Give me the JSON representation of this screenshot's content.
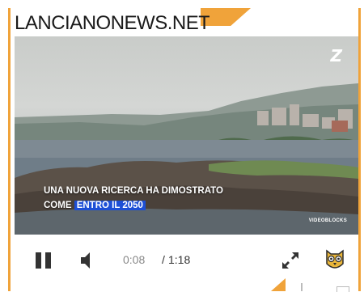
{
  "site": {
    "title": "LANCIANONEWS.NET"
  },
  "video": {
    "logo": "Z",
    "caption_line1": "UNA NUOVA RICERCA HA DIMOSTRATO",
    "caption_line2_prefix": "COME",
    "caption_line2_highlight": "ENTRO IL 2050",
    "credit": "VIDEOBLOCKS"
  },
  "player": {
    "current_time": "0:08",
    "separator": "/",
    "duration": "1:18",
    "icons": {
      "pause": "pause-icon",
      "volume": "volume-icon",
      "fullscreen": "fullscreen-icon",
      "brand": "owl-logo-icon"
    }
  },
  "colors": {
    "accent": "#f0a33a",
    "highlight": "#1d4fd6"
  }
}
